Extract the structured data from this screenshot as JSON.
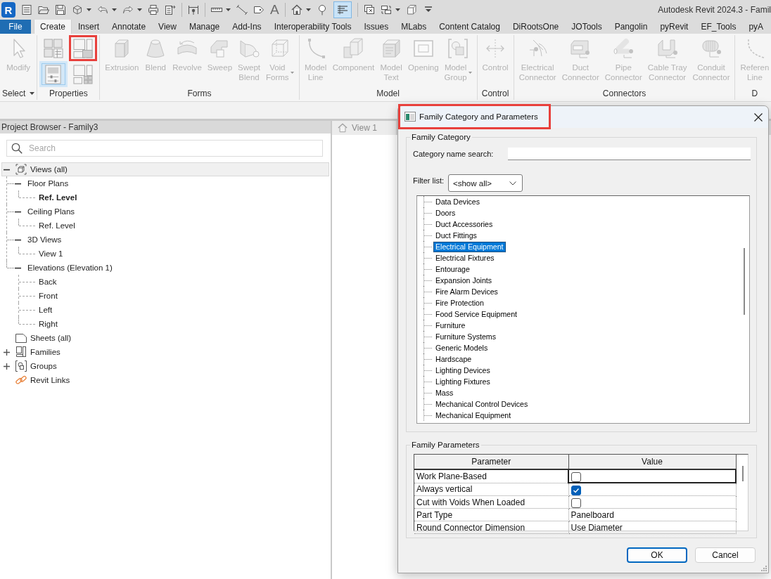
{
  "title_bar": {
    "logo": "R",
    "text_tool_glyph": "A",
    "toggle_button": {
      "on": true
    },
    "title": "Autodesk Revit 2024.3 - Famil"
  },
  "ribbon_tabs": [
    {
      "label": "File",
      "kind": "application",
      "selected": false
    },
    {
      "label": "Create",
      "kind": "tab",
      "selected": true
    },
    {
      "label": "Insert",
      "kind": "tab",
      "selected": false
    },
    {
      "label": "Annotate",
      "kind": "tab",
      "selected": false
    },
    {
      "label": "View",
      "kind": "tab",
      "selected": false
    },
    {
      "label": "Manage",
      "kind": "tab",
      "selected": false
    },
    {
      "label": "Add-Ins",
      "kind": "tab",
      "selected": false
    },
    {
      "label": "Interoperability Tools",
      "kind": "tab",
      "selected": false
    },
    {
      "label": "Issues",
      "kind": "tab",
      "selected": false
    },
    {
      "label": "MLabs",
      "kind": "tab",
      "selected": false
    },
    {
      "label": "Content Catalog",
      "kind": "tab",
      "selected": false
    },
    {
      "label": "DiRootsOne",
      "kind": "tab",
      "selected": false
    },
    {
      "label": "JOTools",
      "kind": "tab",
      "selected": false
    },
    {
      "label": "Pangolin",
      "kind": "tab",
      "selected": false
    },
    {
      "label": "pyRevit",
      "kind": "tab",
      "selected": false
    },
    {
      "label": "EF_Tools",
      "kind": "tab",
      "selected": false
    },
    {
      "label": "pyA",
      "kind": "tab",
      "selected": false
    }
  ],
  "ribbon_panels": [
    {
      "title": "Select",
      "menu": true,
      "kind": "large",
      "tools": [
        {
          "label": "Modify",
          "dropdown": false,
          "disabled": true
        }
      ]
    },
    {
      "title": "Properties",
      "menu": false,
      "kind": "grid",
      "tools": [
        {
          "on": false,
          "highlighted": false
        },
        {
          "on": false,
          "highlighted": true
        },
        {
          "on": true,
          "highlighted": false
        },
        {
          "on": false,
          "highlighted": false
        }
      ]
    },
    {
      "title": "Forms",
      "menu": false,
      "kind": "large",
      "tools": [
        {
          "label": "Extrusion",
          "dropdown": false,
          "disabled": true
        },
        {
          "label": "Blend",
          "dropdown": false,
          "disabled": true
        },
        {
          "label": "Revolve",
          "dropdown": false,
          "disabled": true
        },
        {
          "label": "Sweep",
          "dropdown": false,
          "disabled": true
        },
        {
          "label": "Swept\nBlend",
          "dropdown": false,
          "disabled": true
        },
        {
          "label": "Void\nForms",
          "dropdown": true,
          "disabled": true
        }
      ]
    },
    {
      "title": "Model",
      "menu": false,
      "kind": "large",
      "tools": [
        {
          "label": "Model\nLine",
          "dropdown": false,
          "disabled": true
        },
        {
          "label": "Component",
          "dropdown": false,
          "disabled": true
        },
        {
          "label": "Model\nText",
          "dropdown": false,
          "disabled": true
        },
        {
          "label": "Opening",
          "dropdown": false,
          "disabled": true
        },
        {
          "label": "Model\nGroup",
          "dropdown": true,
          "disabled": true
        }
      ]
    },
    {
      "title": "Control",
      "menu": false,
      "kind": "large",
      "tools": [
        {
          "label": "Control",
          "dropdown": false,
          "disabled": true
        }
      ]
    },
    {
      "title": "Connectors",
      "menu": false,
      "kind": "large",
      "tools": [
        {
          "label": "Electrical\nConnector",
          "dropdown": false,
          "disabled": true
        },
        {
          "label": "Duct\nConnector",
          "dropdown": false,
          "disabled": true
        },
        {
          "label": "Pipe\nConnector",
          "dropdown": false,
          "disabled": true
        },
        {
          "label": "Cable Tray\nConnector",
          "dropdown": false,
          "disabled": true
        },
        {
          "label": "Conduit\nConnector",
          "dropdown": false,
          "disabled": true
        }
      ]
    },
    {
      "title": "D",
      "menu": false,
      "kind": "large",
      "tools": [
        {
          "label": "Referen\nLine",
          "dropdown": false,
          "disabled": true
        }
      ]
    }
  ],
  "project_browser": {
    "title": "Project Browser - Family3",
    "search": {
      "placeholder": "Search"
    },
    "tree": [
      {
        "label": "Views (all)",
        "kind": "views",
        "expanded": true,
        "selected": true,
        "children": [
          {
            "label": "Floor Plans",
            "expanded": true,
            "selected": false,
            "children": [
              {
                "label": "Ref. Level",
                "current": true,
                "selected": false
              }
            ]
          },
          {
            "label": "Ceiling Plans",
            "expanded": true,
            "selected": false,
            "children": [
              {
                "label": "Ref. Level",
                "current": false,
                "selected": false
              }
            ]
          },
          {
            "label": "3D Views",
            "expanded": true,
            "selected": false,
            "children": [
              {
                "label": "View 1",
                "current": false,
                "selected": false
              }
            ]
          },
          {
            "label": "Elevations (Elevation 1)",
            "expanded": true,
            "selected": false,
            "children": [
              {
                "label": "Back",
                "current": false,
                "selected": false
              },
              {
                "label": "Front",
                "current": false,
                "selected": false
              },
              {
                "label": "Left",
                "current": false,
                "selected": false
              },
              {
                "label": "Right",
                "current": false,
                "selected": false
              }
            ]
          }
        ]
      },
      {
        "label": "Sheets (all)",
        "kind": "sheets",
        "selected": false
      },
      {
        "label": "Families",
        "kind": "families",
        "expanded": false,
        "selected": false
      },
      {
        "label": "Groups",
        "kind": "groups",
        "expanded": false,
        "selected": false
      },
      {
        "label": "Revit Links",
        "kind": "links",
        "selected": false
      }
    ]
  },
  "view_tab": {
    "label": "View 1"
  },
  "dialog": {
    "title": "Family Category and Parameters",
    "highlighted": true,
    "category_group": {
      "legend": "Family Category",
      "search_label": "Category name search:",
      "filter_label": "Filter list:",
      "filter_value": "<show all>",
      "categories": [
        {
          "label": "Data Devices",
          "selected": false
        },
        {
          "label": "Doors",
          "selected": false
        },
        {
          "label": "Duct Accessories",
          "selected": false
        },
        {
          "label": "Duct Fittings",
          "selected": false
        },
        {
          "label": "Electrical Equipment",
          "selected": true
        },
        {
          "label": "Electrical Fixtures",
          "selected": false
        },
        {
          "label": "Entourage",
          "selected": false
        },
        {
          "label": "Expansion Joints",
          "selected": false
        },
        {
          "label": "Fire Alarm Devices",
          "selected": false
        },
        {
          "label": "Fire Protection",
          "selected": false
        },
        {
          "label": "Food Service Equipment",
          "selected": false
        },
        {
          "label": "Furniture",
          "selected": false
        },
        {
          "label": "Furniture Systems",
          "selected": false
        },
        {
          "label": "Generic Models",
          "selected": false
        },
        {
          "label": "Hardscape",
          "selected": false
        },
        {
          "label": "Lighting Devices",
          "selected": false
        },
        {
          "label": "Lighting Fixtures",
          "selected": false
        },
        {
          "label": "Mass",
          "selected": false
        },
        {
          "label": "Mechanical Control Devices",
          "selected": false
        },
        {
          "label": "Mechanical Equipment",
          "selected": false
        }
      ]
    },
    "parameters_group": {
      "legend": "Family Parameters",
      "columns": [
        "Parameter",
        "Value"
      ],
      "rows": [
        {
          "parameter": "Work Plane-Based",
          "kind": "checkbox",
          "checked": false,
          "focused": true
        },
        {
          "parameter": "Always vertical",
          "kind": "checkbox",
          "checked": true,
          "focused": false
        },
        {
          "parameter": "Cut with Voids When Loaded",
          "kind": "checkbox",
          "checked": false,
          "focused": false
        },
        {
          "parameter": "Part Type",
          "kind": "text",
          "value": "Panelboard",
          "focused": false
        },
        {
          "parameter": "Round Connector Dimension",
          "kind": "text",
          "value": "Use Diameter",
          "focused": false
        }
      ]
    },
    "buttons": [
      {
        "label": "OK",
        "default": true
      },
      {
        "label": "Cancel",
        "default": false
      }
    ]
  }
}
